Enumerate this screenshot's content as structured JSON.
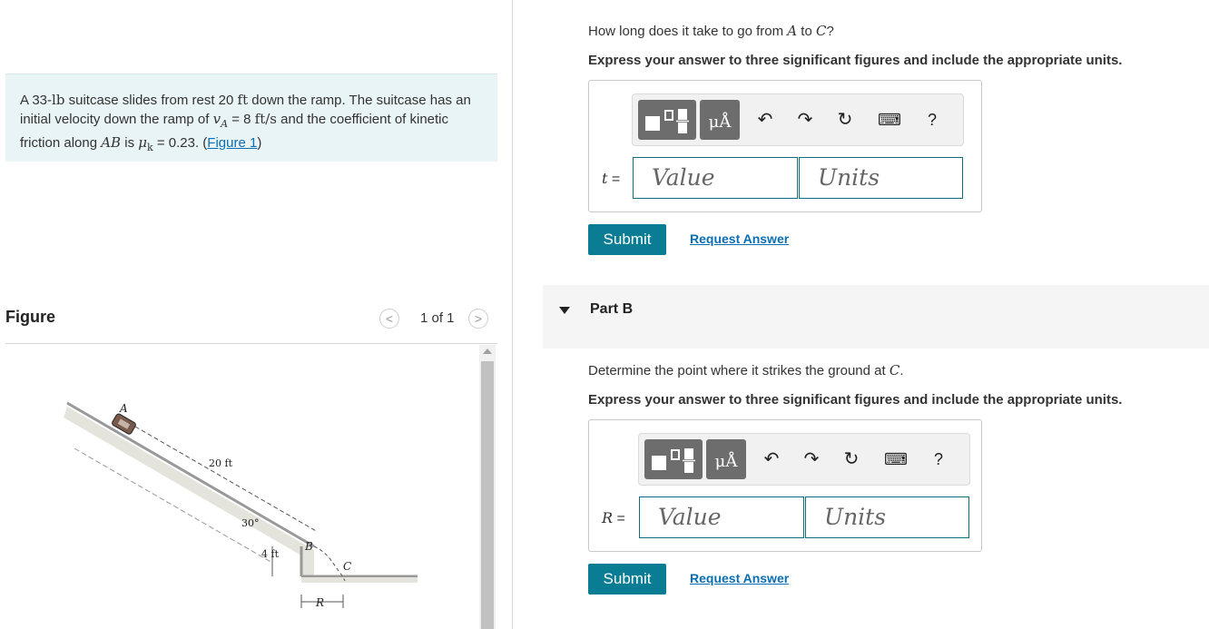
{
  "problem": {
    "text_1": "A 33-",
    "unit_lb": "lb",
    "text_2": " suitcase slides from rest 20 ",
    "unit_ft": "ft",
    "text_3": " down the ramp. The suitcase has an initial velocity down the ramp of ",
    "vA": "v",
    "vA_sub": "A",
    "text_4": " = 8 ",
    "unit_fts": "ft/s",
    "text_5": " and the coefficient of kinetic friction along ",
    "AB": "AB",
    "text_6": " is ",
    "mu": "μ",
    "mu_sub": "k",
    "text_7": " = 0.23. (",
    "figure_link": "Figure 1",
    "text_8": ")"
  },
  "figure": {
    "title": "Figure",
    "pager": "1 of 1",
    "prev": "<",
    "next": ">",
    "labels": {
      "A": "A",
      "dist": "20 ft",
      "angle": "30°",
      "height": "4 ft",
      "B": "B",
      "C": "C",
      "R": "R"
    }
  },
  "partA": {
    "question_1": "How long does it take to go from ",
    "A": "A",
    "question_2": " to ",
    "C": "C",
    "question_3": "?",
    "instruction": "Express your answer to three significant figures and include the appropriate units.",
    "var_label": "t",
    "equals": " =",
    "value_placeholder": "Value",
    "units_placeholder": "Units",
    "submit": "Submit",
    "request": "Request Answer"
  },
  "partB": {
    "label": "Part B",
    "question_1": "Determine the point where it strikes the ground at ",
    "C": "C",
    "question_2": ".",
    "instruction": "Express your answer to three significant figures and include the appropriate units.",
    "var_label": "R",
    "equals": " =",
    "value_placeholder": "Value",
    "units_placeholder": "Units",
    "submit": "Submit",
    "request": "Request Answer"
  },
  "toolbar": {
    "units_glyph": "μÅ",
    "undo": "↶",
    "redo": "↷",
    "reset": "↻",
    "keyboard": "⌨",
    "help": "?"
  }
}
